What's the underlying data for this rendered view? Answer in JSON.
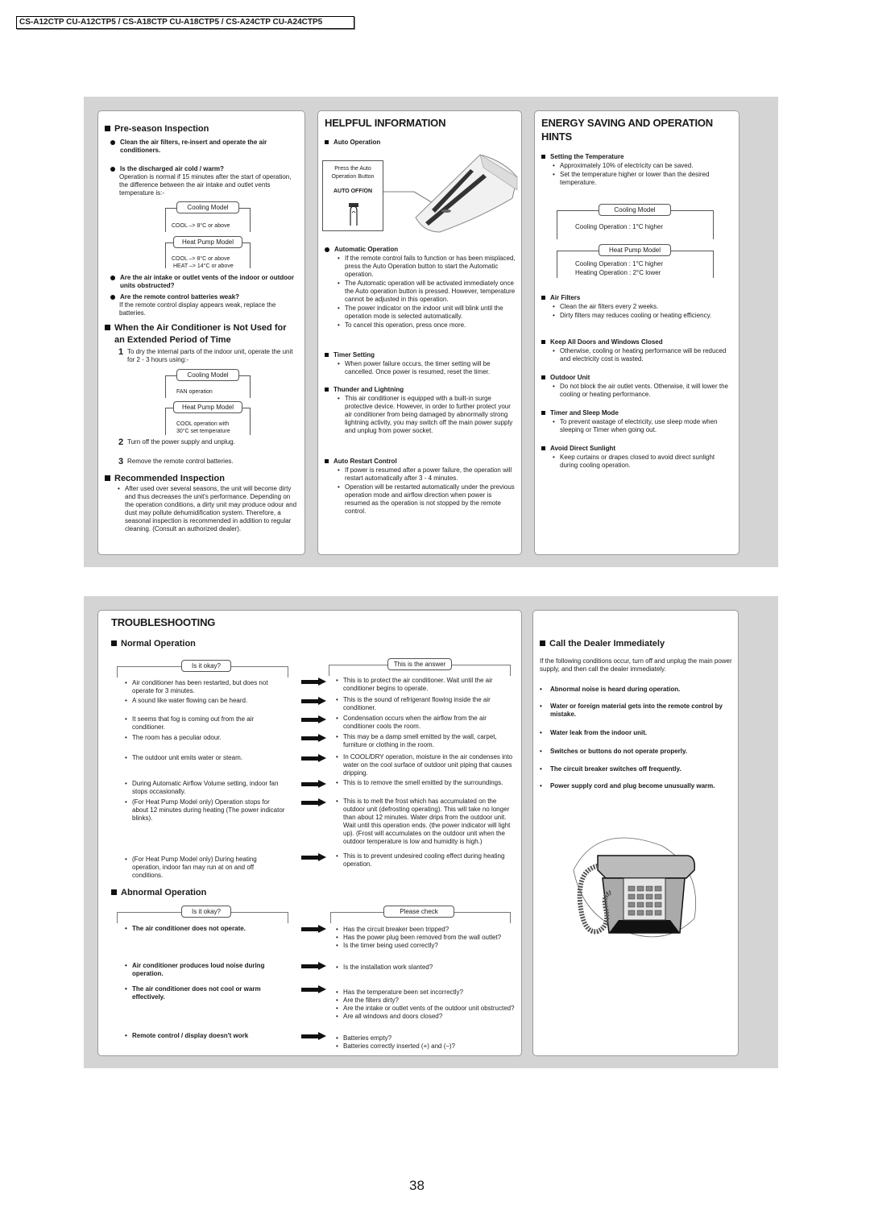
{
  "header": {
    "models": "CS-A12CTP CU-A12CTP5 / CS-A18CTP CU-A18CTP5 / CS-A24CTP CU-A24CTP5"
  },
  "preseason": {
    "title": "Pre-season Inspection",
    "item1": "Clean the air filters, re-insert and operate the air conditioners.",
    "item2_title": "Is the discharged air cold / warm?",
    "item2_text": "Operation is normal if 15 minutes after the start of operation, the difference between the air intake and outlet vents temperature is:-",
    "cooling_label": "Cooling Model",
    "cooling_val": "COOL –> 8°C or above",
    "heatpump_label": "Heat Pump Model",
    "heatpump_val1": "COOL –> 8°C or above",
    "heatpump_val2": "HEAT –> 14°C or above",
    "item3": "Are the air intake or outlet vents of the indoor or outdoor units obstructed?",
    "item4_title": "Are the remote control batteries weak?",
    "item4_text": "If the remote control display appears weak, replace the batteries."
  },
  "not_used": {
    "title": "When the Air Conditioner is Not Used for an Extended Period of Time",
    "step1_num": "1",
    "step1": "To dry the internal parts of the indoor unit, operate the unit for 2 - 3 hours using:-",
    "cooling_label": "Cooling Model",
    "cooling_val": "FAN operation",
    "heatpump_label": "Heat Pump Model",
    "heatpump_val1": "COOL operation with",
    "heatpump_val2": "30°C set temperature",
    "step2_num": "2",
    "step2": "Turn off the power supply and unplug.",
    "step3_num": "3",
    "step3": "Remove the remote control batteries."
  },
  "recommended": {
    "title": "Recommended Inspection",
    "text": "After used over several seasons, the unit will become dirty and thus decreases the unit's performance. Depending on the operation conditions, a dirty unit may produce odour and dust may pollute dehumidification system. Therefore, a seasonal inspection is recommended in addition to regular cleaning. (Consult an authorized dealer)."
  },
  "helpful": {
    "title": "HELPFUL INFORMATION",
    "auto_op_title": "Auto Operation",
    "callout_line1": "Press the Auto",
    "callout_line2": "Operation Button",
    "callout_button": "AUTO OFF/ON",
    "automatic_title": "Automatic Operation",
    "automatic_items": [
      "If the remote control fails to function or has been misplaced, press the Auto Operation button to start the Automatic operation.",
      "The Automatic operation will be activated immediately once the Auto operation button is pressed. However, temperature cannot be adjusted in this operation.",
      "The power indicator on the indoor unit will blink until the operation mode is selected automatically.",
      "To cancel this operation, press once more."
    ],
    "timer_title": "Timer Setting",
    "timer_items": [
      "When power failure occurs, the timer setting will be cancelled. Once power is resumed, reset the timer."
    ],
    "thunder_title": "Thunder and Lightning",
    "thunder_items": [
      "This air conditioner is equipped with a built-in surge protective device. However, in order to further protect your air conditioner from being damaged by abnormally strong lightning activity, you may switch off the main power supply and unplug from power socket."
    ],
    "restart_title": "Auto Restart Control",
    "restart_items": [
      "If power is resumed after a power failure, the operation will restart automatically after 3 - 4 minutes.",
      "Operation will be restarted automatically under the previous operation mode and airflow direction when power is resumed as the operation is not stopped by the remote control."
    ]
  },
  "energy": {
    "title_line1": "ENERGY SAVING AND OPERATION",
    "title_line2": "HINTS",
    "temp_title": "Setting the Temperature",
    "temp_items": [
      "Approximately 10% of electricity can be saved.",
      "Set the temperature higher or lower than the desired temperature."
    ],
    "cooling_label": "Cooling Model",
    "cooling_val": "Cooling Operation : 1°C higher",
    "heatpump_label": "Heat Pump Model",
    "heatpump_val1": "Cooling Operation : 1°C higher",
    "heatpump_val2": "Heating Operation : 2°C lower",
    "filters_title": "Air Filters",
    "filters_items": [
      "Clean the air filters every 2 weeks.",
      "Dirty filters may reduces cooling or heating efficiency."
    ],
    "doors_title": "Keep All Doors and Windows Closed",
    "doors_items": [
      "Otherwise, cooling or heating performance will be reduced and electricity cost is wasted."
    ],
    "outdoor_title": "Outdoor Unit",
    "outdoor_items": [
      "Do not block the air outlet vents. Otherwise, it will lower the cooling or heating performance."
    ],
    "sleep_title": "Timer and Sleep Mode",
    "sleep_items": [
      "To prevent wastage of electricity, use sleep mode when sleeping or Timer when going out."
    ],
    "sun_title": "Avoid Direct Sunlight",
    "sun_items": [
      "Keep curtains or drapes closed to avoid direct sunlight during cooling operation."
    ]
  },
  "troubleshooting": {
    "title": "TROUBLESHOOTING",
    "normal_title": "Normal Operation",
    "normal_left_label": "Is it okay?",
    "normal_right_label": "This is the answer",
    "normal_rows": [
      {
        "q": "Air conditioner has been restarted, but does not operate for 3 minutes.",
        "a": "This is to protect the air conditioner. Wait until the air conditioner begins to operate."
      },
      {
        "q": "A sound like water flowing can be heard.",
        "a": "This is the sound of refrigerant flowing inside the air conditioner."
      },
      {
        "q": "It seems that fog is coming out from the air conditioner.",
        "a": "Condensation occurs when the airflow from the air conditioner cools the room."
      },
      {
        "q": "The room has a peculiar odour.",
        "a": "This may be a damp smell emitted by the wall, carpet, furniture or clothing in the room."
      },
      {
        "q": "The outdoor unit emits water or steam.",
        "a": "In COOL/DRY operation, moisture in the air condenses into water on the cool surface of outdoor unit piping that causes dripping."
      },
      {
        "q": "During Automatic Airflow Volume setting, indoor fan stops occasionally.",
        "a": "This is to remove the smell emitted by the surroundings."
      },
      {
        "q": "(For Heat Pump Model only) Operation stops for about 12 minutes during heating (The power indicator blinks).",
        "a": "This is to melt the frost which has accumulated on the outdoor unit (defrosting operating). This will take no longer than about 12 minutes. Water drips from the outdoor unit. Wait until this operation ends. (the power indicator will light up). (Frost will accumulates on the outdoor unit when the outdoor temperature is low and humidity is high.)"
      },
      {
        "q": "(For Heat Pump Model only) During heating operation, indoor fan may run at on and off conditions.",
        "a": "This is to prevent undesired cooling effect during heating operation."
      }
    ],
    "abnormal_title": "Abnormal Operation",
    "abnormal_left_label": "Is it okay?",
    "abnormal_right_label": "Please check",
    "abnormal_rows": [
      {
        "q": "The air conditioner does not operate.",
        "a": [
          "Has the circuit breaker been tripped?",
          "Has the power plug been removed from the wall outlet?",
          "Is the timer being used correctly?"
        ]
      },
      {
        "q": "Air conditioner produces loud noise during operation.",
        "a": [
          "Is the installation work slanted?"
        ]
      },
      {
        "q": "The air conditioner does not cool or warm effectively.",
        "a": [
          "Has the temperature been set incorrectly?",
          "Are the filters dirty?",
          "Are the intake or outlet vents of the outdoor unit obstructed?",
          "Are all windows and doors closed?"
        ]
      },
      {
        "q": "Remote control / display doesn't work",
        "a": [
          "Batteries empty?",
          "Batteries correctly inserted (+) and (–)?"
        ]
      }
    ]
  },
  "dealer": {
    "title": "Call the Dealer Immediately",
    "intro": "If the following conditions occur, turn off and unplug the main power supply, and then call the dealer immediately.",
    "items": [
      "Abnormal noise is heard during operation.",
      "Water or foreign material gets into the remote control by mistake.",
      "Water leak from the indoor unit.",
      "Switches or buttons do not operate properly.",
      "The circuit breaker switches off frequently.",
      "Power supply cord and plug become unusually warm."
    ]
  },
  "page_number": "38"
}
